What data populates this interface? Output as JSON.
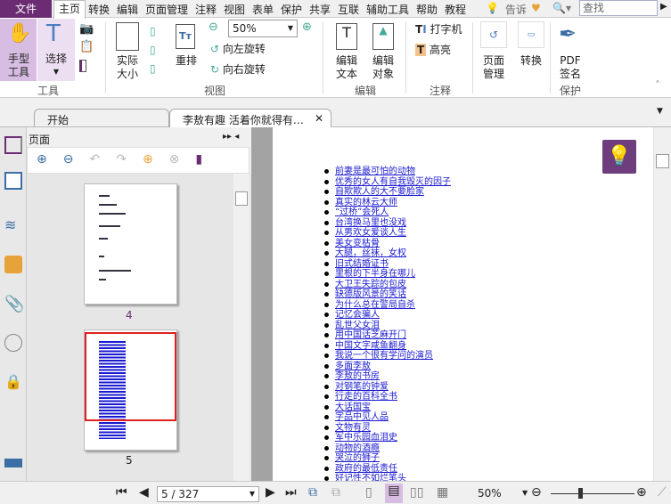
{
  "menu": {
    "file": "文件",
    "home": "主页",
    "items": [
      "转换",
      "编辑",
      "页面管理",
      "注释",
      "视图",
      "表单",
      "保护",
      "共享",
      "互联",
      "辅助工具",
      "帮助",
      "教程"
    ],
    "tell": "告诉",
    "search_placeholder": "查找"
  },
  "ribbon": {
    "hand": "手型\n工具",
    "select": "选择",
    "actual_size": "实际\n大小",
    "reflow": "重排",
    "zoom_value": "50%",
    "rotate_left": "向左旋转",
    "rotate_right": "向右旋转",
    "edit_text": "编辑\n文本",
    "edit_object": "编辑\n对象",
    "typewriter": "打字机",
    "highlight": "高亮",
    "page_manage": "页面\n管理",
    "convert": "转换",
    "pdf_sign": "PDF\n签名",
    "groups": {
      "tools": "工具",
      "view": "视图",
      "edit": "编辑",
      "comment": "注释",
      "protect": "保护"
    }
  },
  "tabs": [
    {
      "label": "开始"
    },
    {
      "label": "李敖有趣 活着你就得有…"
    }
  ],
  "panel": {
    "title": "页面",
    "thumbnails": [
      {
        "label": "4"
      },
      {
        "label": "5"
      }
    ]
  },
  "document": {
    "links": [
      "前妻是最可怕的动物",
      "优秀的女人有自我毁灭的因子",
      "自欺欺人的大不要脸家",
      "真实的林云大师",
      "“过桥”会死人",
      "台湾换马里也没戏",
      "从男欢女爱谈人生",
      "美女变枯骨",
      "大腿，丝袜，女权",
      "旧式结婚证书",
      "里根的下半身在哪儿",
      "大卫王失踪的包皮",
      "缺德版风景的笑话",
      "为什么总在警局自杀",
      "记忆会骗人",
      "乱世父女泪",
      "用中国话芝麻开门",
      "中国文字咸鱼翻身",
      "我说一个很有学问的演员",
      "多面李敖",
      "李敖的书房",
      "对钢笔的钟爱",
      "行走的百科全书",
      "大话国宝",
      "字品中见人品",
      "文物有灵",
      "军中乐园血泪史",
      "动物的酒瘾",
      "哭泣的狮子",
      "政府的最低责任",
      "好记性不如烂笔头"
    ]
  },
  "status": {
    "page": "5 / 327",
    "zoom": "50%",
    "zoom_slider_fraction": 0.35
  },
  "colors": {
    "accent": "#6b2c74",
    "link": "#1a1ad0",
    "selection": "#e02020"
  }
}
